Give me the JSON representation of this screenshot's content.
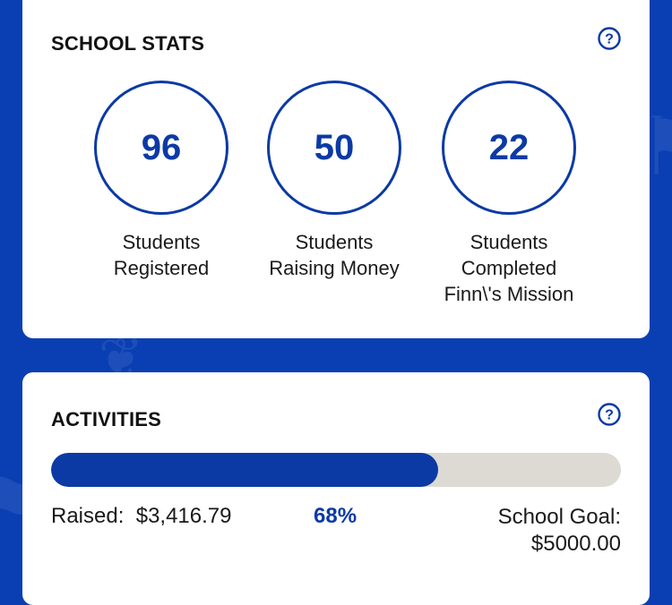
{
  "colors": {
    "background": "#0a3fb3",
    "accent": "#0b3aa5",
    "track": "#dcdad3",
    "card": "#ffffff"
  },
  "school_stats": {
    "title": "SCHOOL STATS",
    "help_icon": "question-circle-icon",
    "stats": [
      {
        "value": "96",
        "label_line1": "Students",
        "label_line2": "Registered",
        "label_line3": ""
      },
      {
        "value": "50",
        "label_line1": "Students",
        "label_line2": "Raising Money",
        "label_line3": ""
      },
      {
        "value": "22",
        "label_line1": "Students",
        "label_line2": "Completed",
        "label_line3": "Finn\\'s Mission"
      }
    ]
  },
  "activities": {
    "title": "ACTIVITIES",
    "help_icon": "question-circle-icon",
    "progress_fraction": 0.68,
    "raised_label": "Raised:",
    "raised_value": "$3,416.79",
    "percent": "68%",
    "goal_label": "School Goal:",
    "goal_value": "$5000.00"
  }
}
